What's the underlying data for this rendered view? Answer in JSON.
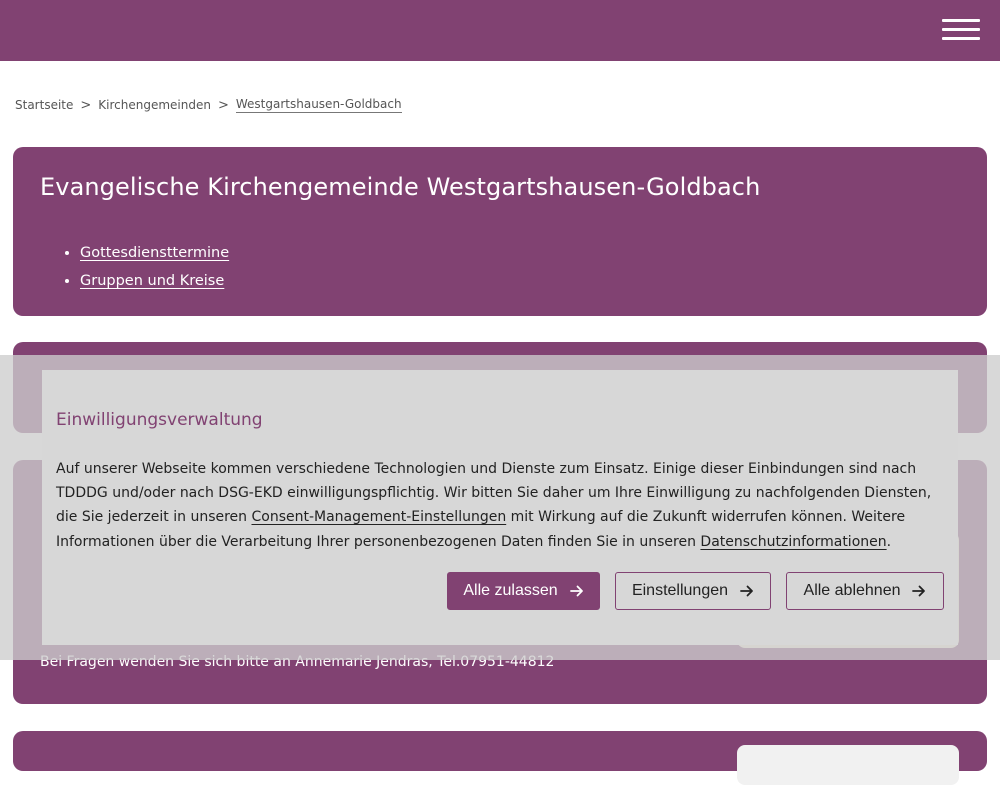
{
  "header": {
    "menu_label": ""
  },
  "breadcrumb": {
    "items": [
      "Startseite",
      "Kirchengemeinden",
      "Westgartshausen-Goldbach"
    ],
    "separator": ">"
  },
  "main": {
    "title": "Evangelische Kirchengemeinde Westgartshausen-Goldbach",
    "links": [
      "Gottesdiensttermine",
      "Gruppen und Kreise"
    ],
    "contact_text": "Bei Fragen wenden Sie sich bitte an Annemarie Jendras, Tel.07951-44812"
  },
  "consent": {
    "title": "Einwilligungsverwaltung",
    "text_1": "Auf unserer Webseite kommen verschiedene Technologien und Dienste zum Einsatz. Einige dieser Einbindungen sind nach TDDDG und/oder nach DSG-EKD einwilligungspflichtig. Wir bitten Sie daher um Ihre Einwilligung zu nachfolgenden Diensten, die Sie jederzeit in unseren ",
    "link_1": "Consent-Management-Einstellungen",
    "text_2": " mit Wirkung auf die Zukunft widerrufen können. Weitere Informationen über die Verarbeitung Ihrer personenbezogenen Daten finden Sie in unseren ",
    "link_2": "Datenschutzinformationen",
    "text_3": ".",
    "buttons": {
      "accept": "Alle zulassen",
      "settings": "Einstellungen",
      "reject": "Alle ablehnen"
    }
  },
  "colors": {
    "brand": "#814272",
    "overlay": "#d7d7d7",
    "text": "#222222"
  },
  "icons": [
    "menu-icon",
    "arrow-right-icon"
  ]
}
